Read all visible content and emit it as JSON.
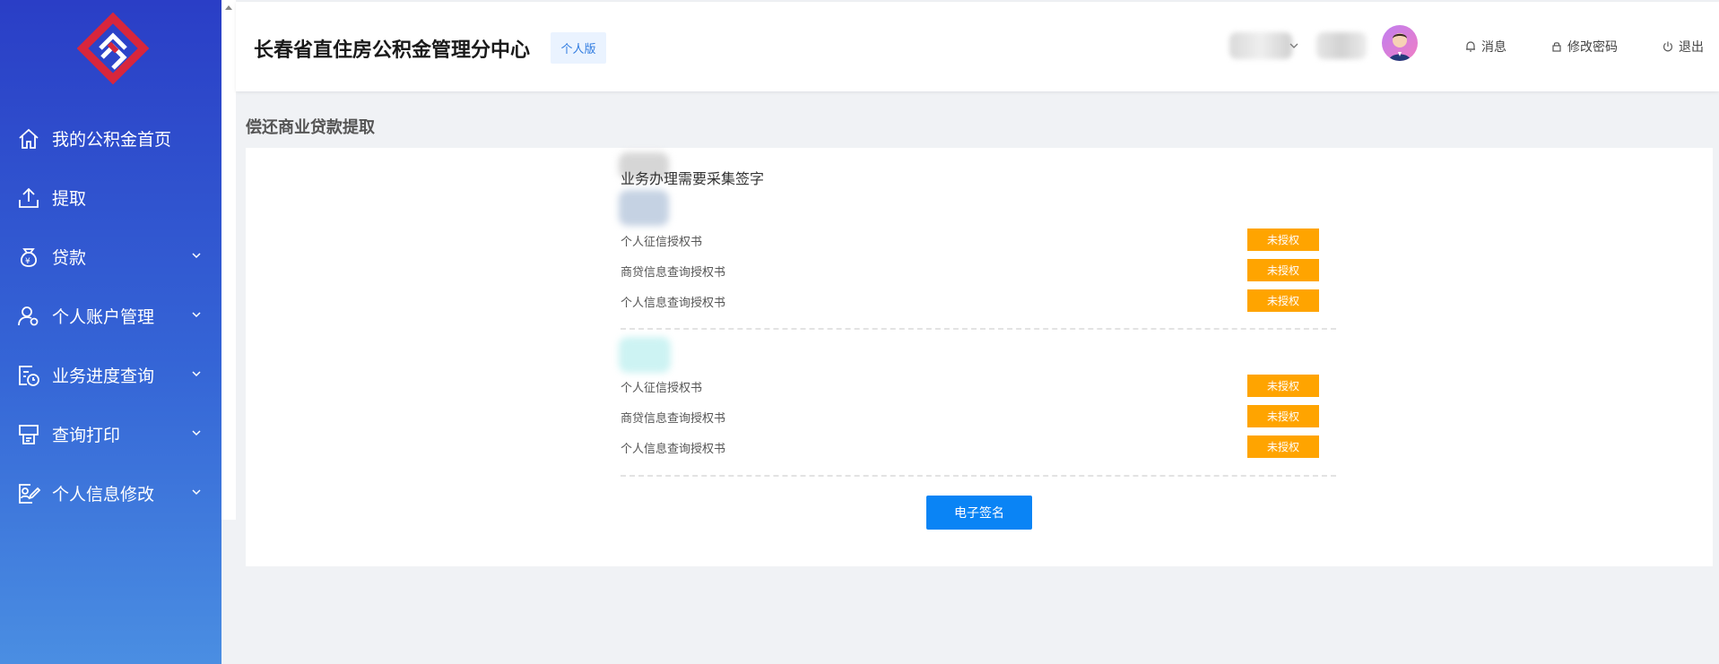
{
  "header": {
    "title": "长春省直住房公积金管理分中心",
    "version_badge": "个人版",
    "actions": {
      "messages": "消息",
      "change_password": "修改密码",
      "logout": "退出"
    }
  },
  "sidebar": {
    "items": [
      {
        "label": "我的公积金首页",
        "icon": "home-icon",
        "has_submenu": false
      },
      {
        "label": "提取",
        "icon": "upload-icon",
        "has_submenu": false
      },
      {
        "label": "贷款",
        "icon": "money-bag-icon",
        "has_submenu": true
      },
      {
        "label": "个人账户管理",
        "icon": "user-settings-icon",
        "has_submenu": true
      },
      {
        "label": "业务进度查询",
        "icon": "progress-clock-icon",
        "has_submenu": true
      },
      {
        "label": "查询打印",
        "icon": "printer-icon",
        "has_submenu": true
      },
      {
        "label": "个人信息修改",
        "icon": "edit-profile-icon",
        "has_submenu": true
      }
    ]
  },
  "main": {
    "page_title": "偿还商业贷款提取",
    "signature_note": "业务办理需要采集签字",
    "groups": [
      {
        "rows": [
          {
            "label": "个人征信授权书",
            "status": "未授权"
          },
          {
            "label": "商贷信息查询授权书",
            "status": "未授权"
          },
          {
            "label": "个人信息查询授权书",
            "status": "未授权"
          }
        ]
      },
      {
        "rows": [
          {
            "label": "个人征信授权书",
            "status": "未授权"
          },
          {
            "label": "商贷信息查询授权书",
            "status": "未授权"
          },
          {
            "label": "个人信息查询授权书",
            "status": "未授权"
          }
        ]
      }
    ],
    "esign_button": "电子签名"
  },
  "colors": {
    "sidebar_top": "#2a3ec6",
    "sidebar_bottom": "#4a8ee2",
    "status_tag": "#ffa400",
    "primary_button": "#0a84f5",
    "logo_red": "#d8263c"
  }
}
